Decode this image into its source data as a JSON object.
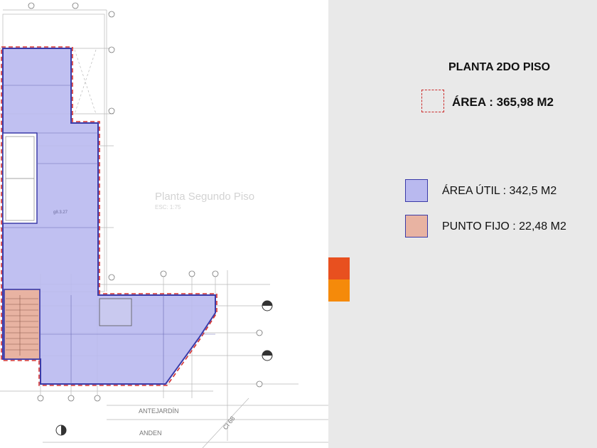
{
  "plan": {
    "watermark_title": "Planta Segundo Piso",
    "watermark_scale": "ESC: 1:75",
    "label_antejardin": "ANTEJARDÍN",
    "label_anden": "ANDEN",
    "label_street": "Cl 68",
    "room_label": "g8.3.27"
  },
  "legend": {
    "title": "PLANTA 2DO PISO",
    "total_area": "ÁREA : 365,98 M2",
    "items": [
      {
        "label": "ÁREA ÚTIL :  342,5 M2",
        "color": "#b9b9ef"
      },
      {
        "label": "PUNTO FIJO : 22,48 M2",
        "color": "#e8b3a2"
      }
    ],
    "accent_colors": [
      "#e8501f",
      "#f58a0a"
    ]
  }
}
